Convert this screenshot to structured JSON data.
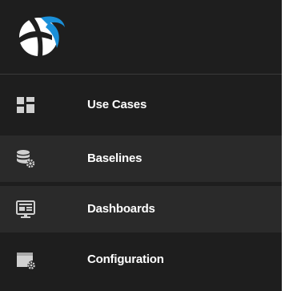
{
  "brand": {
    "logo_icon": "app-logo-icon"
  },
  "colors": {
    "sidebar_bg": "#1e1e1e",
    "highlight_bg": "#2a2a2a",
    "icon_color": "#d0d0d0",
    "label_color": "#ffffff",
    "logo_blue": "#1a8fd8"
  },
  "nav": {
    "items": [
      {
        "label": "Use Cases",
        "icon": "dashboard-grid-icon"
      },
      {
        "label": "Baselines",
        "icon": "database-gear-icon"
      },
      {
        "label": "Dashboards",
        "icon": "monitor-icon"
      },
      {
        "label": "Configuration",
        "icon": "window-gear-icon"
      }
    ]
  }
}
